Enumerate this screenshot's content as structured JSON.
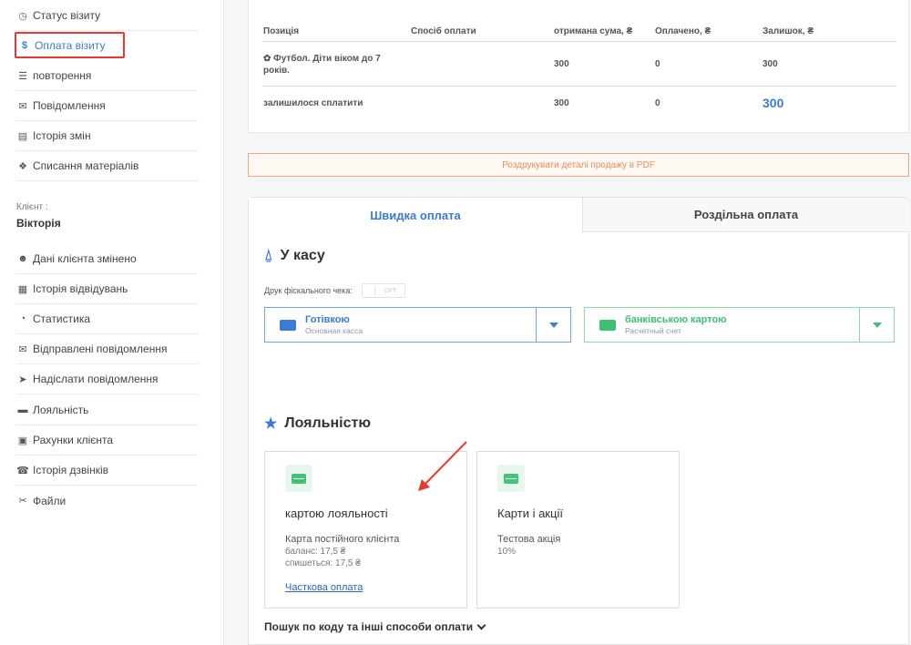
{
  "sidebar": {
    "items": [
      {
        "icon": "clock-icon",
        "glyph": "◷",
        "label": "Статус візиту"
      },
      {
        "icon": "dollar-icon",
        "glyph": "$",
        "label": "Оплата візиту"
      },
      {
        "icon": "list-icon",
        "glyph": "☰",
        "label": "повторення"
      },
      {
        "icon": "chat-icon",
        "glyph": "✉",
        "label": "Повідомлення"
      },
      {
        "icon": "file-icon",
        "glyph": "▤",
        "label": "Історія змін"
      },
      {
        "icon": "cubes-icon",
        "glyph": "❖",
        "label": "Списання матеріалів"
      }
    ],
    "client_label": "Клієнт :",
    "client_name": "Вікторія",
    "client_items": [
      {
        "icon": "user-icon",
        "glyph": "☻",
        "label": "Дані клієнта змінено"
      },
      {
        "icon": "calendar-list-icon",
        "glyph": "▦",
        "label": "Історія відвідувань"
      },
      {
        "icon": "pie-chart-icon",
        "glyph": "◔",
        "label": "Статистика"
      },
      {
        "icon": "envelope-icon",
        "glyph": "✉",
        "label": "Відправлені повідомлення"
      },
      {
        "icon": "send-icon",
        "glyph": "➤",
        "label": "Надіслати повідомлення"
      },
      {
        "icon": "credit-card-icon",
        "glyph": "▬",
        "label": "Лояльність"
      },
      {
        "icon": "briefcase-icon",
        "glyph": "▣",
        "label": "Рахунки клієнта"
      },
      {
        "icon": "phone-icon",
        "glyph": "☎",
        "label": "Історія дзвінків"
      },
      {
        "icon": "paperclip-icon",
        "glyph": "✂",
        "label": "Файли"
      }
    ]
  },
  "table": {
    "headers": [
      "Позиція",
      "Спосіб оплати",
      "отримана сума, ₴",
      "Оплачено, ₴",
      "Залишок, ₴"
    ],
    "row": {
      "position": "✿ Футбол. Діти віком до 7 років.",
      "method": "",
      "received": "300",
      "paid": "0",
      "balance": "300"
    },
    "total": {
      "label": "залишилося сплатити",
      "received": "300",
      "paid": "0",
      "balance": "300"
    }
  },
  "pdf_button": "Роздрукувати деталі продажу в PDF",
  "tabs": {
    "quick": "Швидка оплата",
    "split": "Роздільна оплата"
  },
  "cashbox": {
    "title": "У касу",
    "fiscal_label": "Друк фіскального чека:",
    "toggle_label": "OFF",
    "cash": {
      "name": "Готівкою",
      "sub": "Основная касса",
      "color": "#3b7bd6"
    },
    "card": {
      "name": "банківською картою",
      "sub": "Расчетный счет",
      "color": "#3fbf76"
    }
  },
  "loyalty": {
    "title": "Лояльністю",
    "card1": {
      "title": "картою лояльності",
      "line1": "Карта постійного клієнта",
      "line2": "баланс: 17,5 ₴",
      "line3": "спишеться: 17,5 ₴",
      "link": "Часткова оплата"
    },
    "card2": {
      "title": "Карти і акції",
      "line1": "Тестова акція",
      "line2": "10%"
    }
  },
  "more_link": "Пошук по коду та інші способи оплати"
}
